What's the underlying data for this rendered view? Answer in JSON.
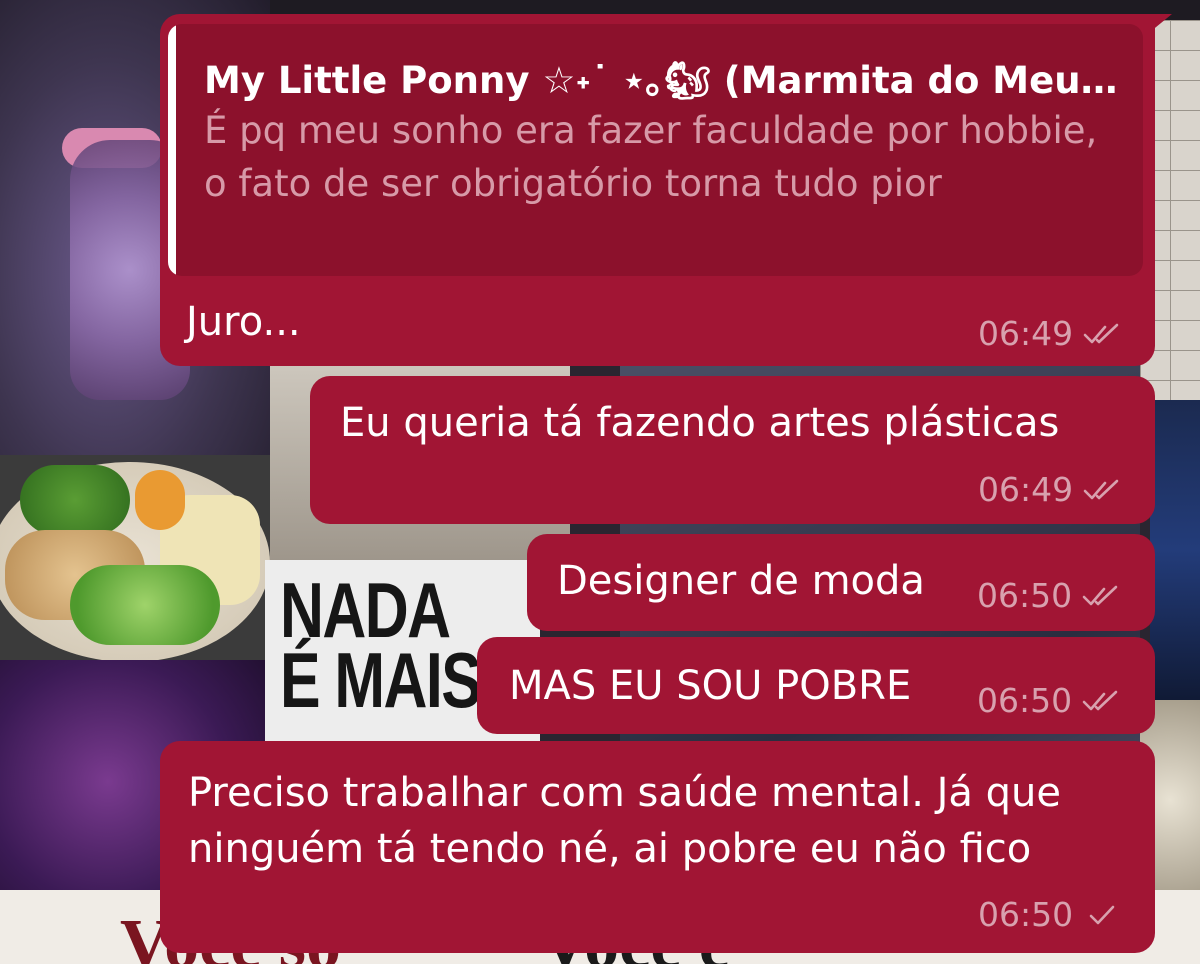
{
  "wallpaper": {
    "poster_text": "NADA É MAIS",
    "bottom_text_left": "Você só",
    "bottom_text_right": "Você é"
  },
  "messages": [
    {
      "reply_to": {
        "author": "My Little Ponny ☆˖˙ ⋆｡🐿 (Marmita do Meu…",
        "text": "É pq meu sonho era fazer faculdade por hobbie, o fato de ser obrigatório torna tudo pior"
      },
      "text": "Juro...",
      "time": "06:49",
      "status": "read"
    },
    {
      "text": "Eu queria tá fazendo artes plásticas",
      "time": "06:49",
      "status": "read"
    },
    {
      "text": "Designer de moda",
      "time": "06:50",
      "status": "read"
    },
    {
      "text": "MAS EU SOU POBRE",
      "time": "06:50",
      "status": "read"
    },
    {
      "text": "Preciso trabalhar com saúde mental. Já que ninguém tá tendo né, ai pobre eu não fico",
      "time": "06:50",
      "status": "sent"
    }
  ],
  "colors": {
    "bubble": "#a11534",
    "quote_bg": "#8c112c",
    "meta_text": "#d8a1ae"
  }
}
